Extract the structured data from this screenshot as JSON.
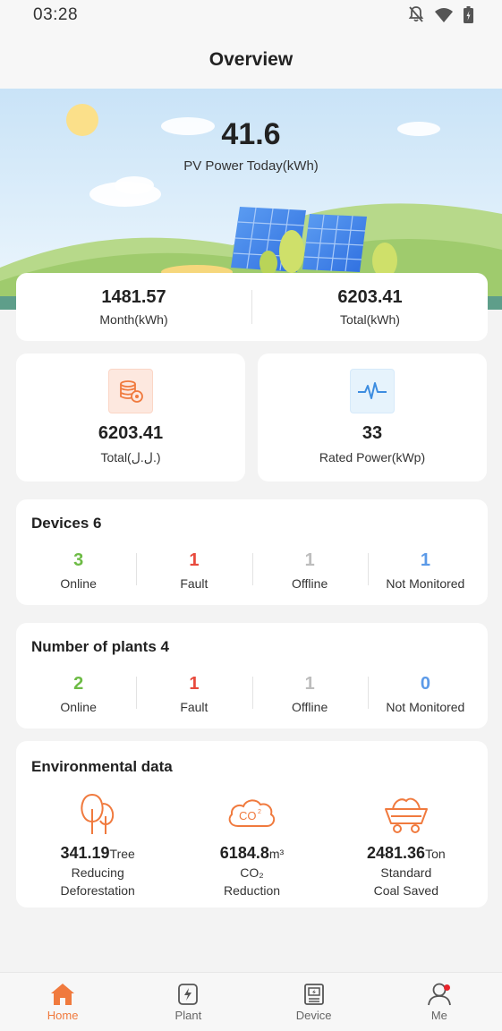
{
  "status_bar": {
    "time": "03:28"
  },
  "header": {
    "title": "Overview"
  },
  "hero": {
    "value": "41.6",
    "label": "PV Power Today(kWh)"
  },
  "summary": {
    "month_value": "1481.57",
    "month_label": "Month(kWh)",
    "total_value": "6203.41",
    "total_label": "Total(kWh)"
  },
  "stats": {
    "income_value": "6203.41",
    "income_label": "Total(ل.ل.)",
    "rated_value": "33",
    "rated_label": "Rated Power(kWp)"
  },
  "devices": {
    "title": "Devices 6",
    "items": [
      {
        "value": "3",
        "label": "Online"
      },
      {
        "value": "1",
        "label": "Fault"
      },
      {
        "value": "1",
        "label": "Offline"
      },
      {
        "value": "1",
        "label": "Not Monitored"
      }
    ]
  },
  "plants": {
    "title": "Number of plants 4",
    "items": [
      {
        "value": "2",
        "label": "Online"
      },
      {
        "value": "1",
        "label": "Fault"
      },
      {
        "value": "1",
        "label": "Offline"
      },
      {
        "value": "0",
        "label": "Not Monitored"
      }
    ]
  },
  "environment": {
    "title": "Environmental data",
    "items": [
      {
        "value": "341.19",
        "unit": "Tree",
        "label_line1": "Reducing",
        "label_line2": "Deforestation"
      },
      {
        "value": "6184.8",
        "unit": "m³",
        "label_line1": "CO₂",
        "label_line2": "Reduction"
      },
      {
        "value": "2481.36",
        "unit": "Ton",
        "label_line1": "Standard",
        "label_line2": "Coal Saved"
      }
    ]
  },
  "tabs": [
    {
      "label": "Home"
    },
    {
      "label": "Plant"
    },
    {
      "label": "Device"
    },
    {
      "label": "Me"
    }
  ],
  "colors": {
    "accent": "#f07a3e",
    "online": "#6dbb45",
    "fault": "#e84a3d",
    "offline": "#bdbdbd",
    "not_monitored": "#5b9ae8"
  },
  "icons": {
    "status": [
      "bell-off-icon",
      "wifi-icon",
      "battery-icon"
    ],
    "stats": [
      "coins-icon",
      "pulse-icon"
    ],
    "environment": [
      "tree-icon",
      "co2-cloud-icon",
      "coal-cart-icon"
    ],
    "tabs": [
      "home-icon",
      "plant-icon",
      "device-icon",
      "user-icon"
    ]
  }
}
